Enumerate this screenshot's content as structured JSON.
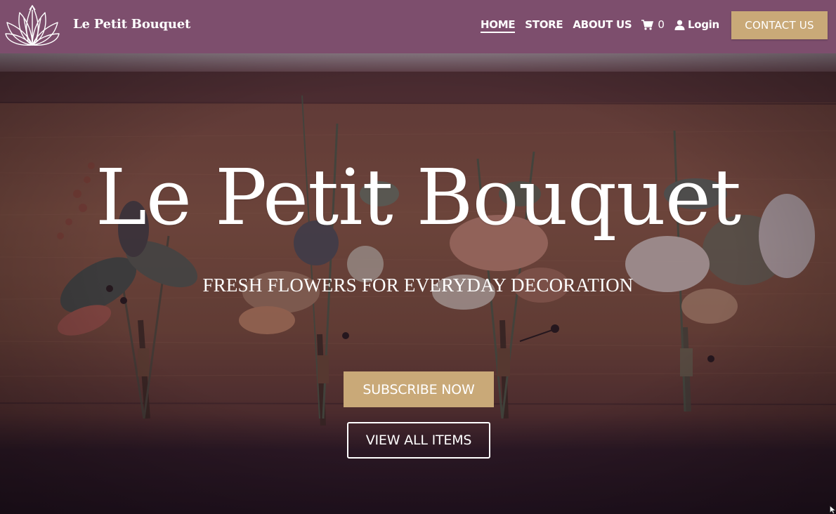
{
  "header": {
    "brand": "Le Petit Bouquet",
    "nav": {
      "home": "HOME",
      "store": "STORE",
      "about": "ABOUT US",
      "cart_count": "0",
      "login": "Login"
    },
    "contact_label": "CONTACT US",
    "icons": {
      "logo": "lotus-logo-icon",
      "cart": "shopping-cart-icon",
      "login": "user-icon"
    }
  },
  "hero": {
    "title": "Le Petit Bouquet",
    "subtitle": "FRESH FLOWERS FOR EVERYDAY DECORATION",
    "subscribe_label": "SUBSCRIBE NOW",
    "view_label": "VIEW ALL ITEMS"
  },
  "colors": {
    "header_bg": "#7d4e6d",
    "accent": "#c9a978",
    "hero_overlay": "#2a1526",
    "text": "#ffffff"
  }
}
